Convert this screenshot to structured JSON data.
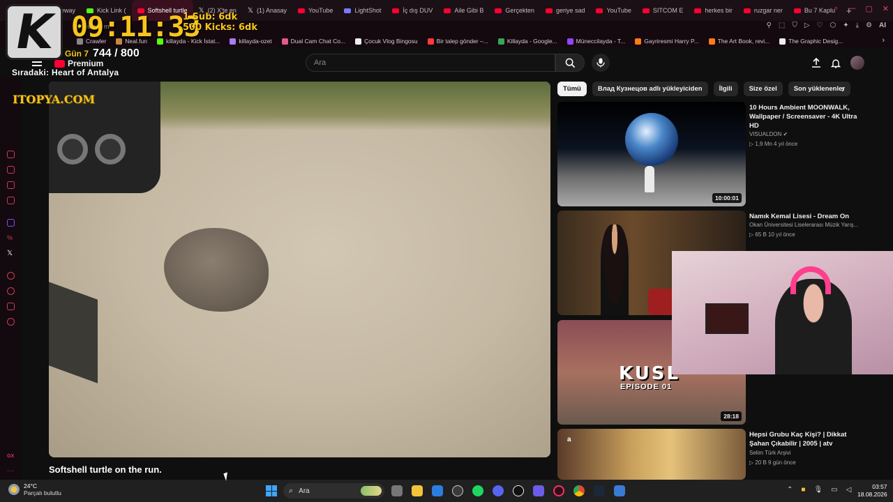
{
  "browser": {
    "tabs": [
      {
        "label": "eway",
        "icon": "kick-icon"
      },
      {
        "label": "Kick Link (",
        "icon": "kick-icon"
      },
      {
        "label": "Softshell turtle",
        "icon": "youtube-icon",
        "active": true
      },
      {
        "label": "(2) X'te en",
        "icon": "x-icon"
      },
      {
        "label": "(1) Anasay",
        "icon": "x-icon"
      },
      {
        "label": "YouTube",
        "icon": "youtube-icon"
      },
      {
        "label": "LightShot",
        "icon": "lightshot-icon"
      },
      {
        "label": "İç dış DUV",
        "icon": "youtube-icon"
      },
      {
        "label": "Aile Gibi B",
        "icon": "youtube-icon"
      },
      {
        "label": "Gerçekten",
        "icon": "youtube-icon"
      },
      {
        "label": "geriye sad",
        "icon": "youtube-icon"
      },
      {
        "label": "YouTube",
        "icon": "youtube-icon"
      },
      {
        "label": "SITCOM E",
        "icon": "youtube-icon"
      },
      {
        "label": "herkes bir",
        "icon": "youtube-icon"
      },
      {
        "label": "ruzgar ner",
        "icon": "youtube-icon"
      },
      {
        "label": "Bu 7 Kaplu",
        "icon": "youtube-icon"
      }
    ],
    "new_tab": "+",
    "address_partial": "youtube.com",
    "ai_label": "AI",
    "bookmarks": [
      {
        "label": "Crawler",
        "color": "#888"
      },
      {
        "label": "Neal.fun",
        "color": "#c08a3e"
      },
      {
        "label": "killayda - Kick İstat...",
        "color": "#53fc18"
      },
      {
        "label": "killayda-ozet",
        "color": "#a97cf5"
      },
      {
        "label": "Dual Cam Chat Co...",
        "color": "#e55a8a"
      },
      {
        "label": "Çocuk Vlog Bingosu",
        "color": "#eee"
      },
      {
        "label": "Bir talep gönder –...",
        "color": "#ff3b3b"
      },
      {
        "label": "Killayda - Google...",
        "color": "#34a853"
      },
      {
        "label": "Müneccilayda - T...",
        "color": "#9146ff"
      },
      {
        "label": "Gayriresmi Harry P...",
        "color": "#ff7a1a"
      },
      {
        "label": "The Art Book, revi...",
        "color": "#ff7a1a"
      },
      {
        "label": "The Graphic Desig...",
        "color": "#eee"
      }
    ]
  },
  "overlay": {
    "logo_letter": "K",
    "clock": "09:11:33",
    "goal_subs": "1 Sub: 6dk",
    "goal_kicks": "500 Kicks: 6dk",
    "day": "Gün 7",
    "count": "744 / 800",
    "next_label": "Sıradaki: Heart of Antalya",
    "watermark": "ITOPYA.COM"
  },
  "youtube": {
    "logo_text": "Premium",
    "search_placeholder": "Ara",
    "video_title": "Softshell turtle on the run.",
    "chips": [
      "Tümü",
      "Влад Кузнецов adlı yükleyiciden",
      "İlgili",
      "Size özel",
      "Son yüklenenler"
    ],
    "recommendations": [
      {
        "title": "10 Hours Ambient MOONWALK, Wallpaper / Screensaver - 4K Ultra HD",
        "channel": "VISUALDON",
        "verified": true,
        "meta": "1,9 Mn   4 yıl önce",
        "duration": "10:00:01"
      },
      {
        "title": "Namık Kemal Lisesi - Dream On",
        "channel": "Okan Üniversitesi Liselerarası Müzik Yarış...",
        "meta": "65 B   10 yıl önce",
        "duration": ""
      },
      {
        "title": "",
        "channel": "",
        "meta": "",
        "duration": "28:18",
        "thumb_text": "KUSL",
        "thumb_sub": "EPISODE 01"
      },
      {
        "title": "Hepsi Grubu Kaç Kişi? | Dikkat Şahan Çıkabilir | 2005 | atv",
        "channel": "Selim Türk Arşivi",
        "meta": "20 B   9 gün önce",
        "duration": ""
      }
    ]
  },
  "taskbar": {
    "weather_temp": "24°C",
    "weather_desc": "Parçalı bulutlu",
    "search_label": "Ara",
    "time": "03:57",
    "date": "18.08.2026",
    "sidebar_bottom_label": "GX"
  }
}
